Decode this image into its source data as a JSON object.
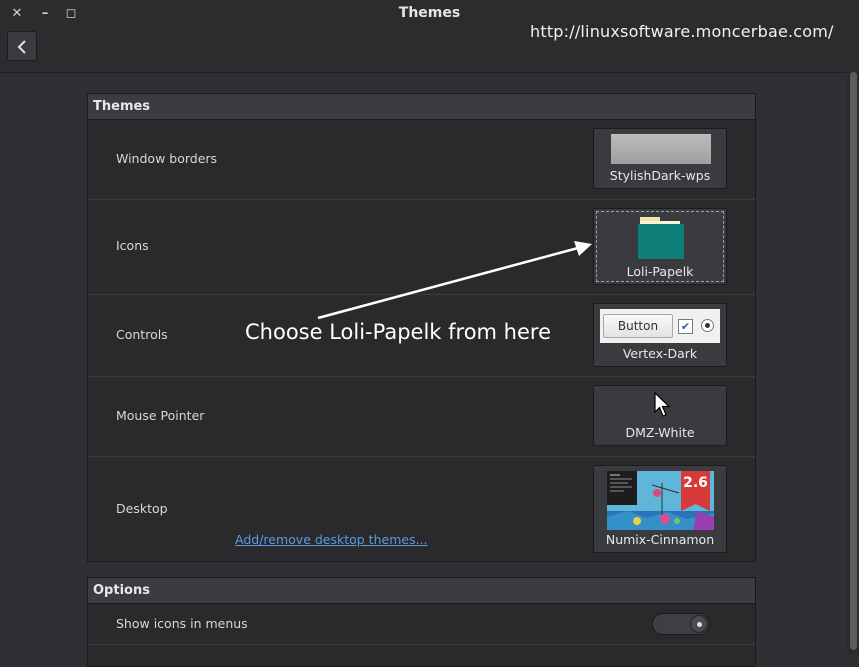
{
  "window": {
    "title": "Themes",
    "close_glyph": "✕",
    "min_glyph": "–",
    "max_glyph": "◻"
  },
  "watermark_url": "http://linuxsoftware.moncerbae.com/",
  "themes": {
    "header": "Themes",
    "rows": [
      {
        "label": "Window borders",
        "value": "StylishDark-wps"
      },
      {
        "label": "Icons",
        "value": "Loli-Papelk"
      },
      {
        "label": "Controls",
        "value": "Vertex-Dark"
      },
      {
        "label": "Mouse Pointer",
        "value": "DMZ-White"
      },
      {
        "label": "Desktop",
        "value": "Numix-Cinnamon"
      }
    ],
    "controls_preview_button": "Button",
    "desktop_preview_version": "2.6",
    "add_remove_link": "Add/remove desktop themes..."
  },
  "annotation": "Choose Loli-Papelk from here",
  "options": {
    "header": "Options",
    "show_icons_in_menus": "Show icons in menus"
  },
  "colors": {
    "accent_link": "#5a9ae0",
    "folder": "#0f7e79",
    "folder_tab": "#f3e6a0"
  }
}
